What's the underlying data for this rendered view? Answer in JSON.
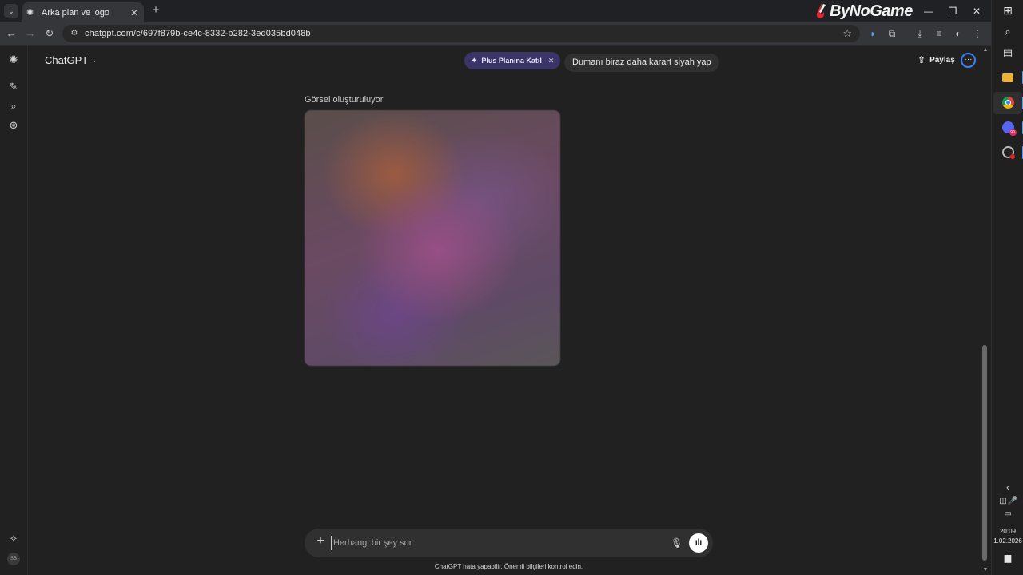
{
  "browser": {
    "tab_title": "Arka plan ve logo",
    "brand": "ByNoGame",
    "url": "chatgpt.com/c/697f879b-ce4c-8332-b282-3ed035bd048b"
  },
  "header": {
    "model_label": "ChatGPT",
    "upgrade_pill": "Plus Planına Katıl",
    "share_label": "Paylaş"
  },
  "conversation": {
    "user_message": "Dumanı biraz daha karart siyah yap",
    "status_label": "Görsel oluşturuluyor"
  },
  "composer": {
    "placeholder": "Herhangi bir şey sor"
  },
  "footer": {
    "disclaimer": "ChatGPT hata yapabilir. Önemli bilgileri kontrol edin."
  },
  "taskbar": {
    "time": "20:09",
    "date": "1.02.2026",
    "discord_badge": "99"
  },
  "colors": {
    "page_bg": "#212121",
    "pill_bg": "#3b3567",
    "accent": "#3b82f6"
  }
}
